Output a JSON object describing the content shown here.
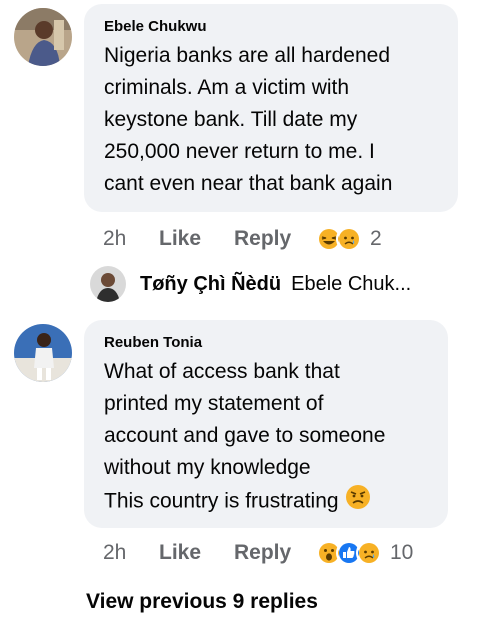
{
  "comments": [
    {
      "author": "Ebele Chukwu",
      "text": "Nigeria banks are all hardened\ncriminals. Am a victim with\nkeystone bank. Till date my\n250,000 never return to me. I\ncant even near that bank again",
      "time": "2h",
      "like_label": "Like",
      "reply_label": "Reply",
      "reaction_icons": [
        "haha-icon",
        "sad-icon"
      ],
      "reaction_count": "2"
    },
    {
      "author": "Reuben Tonia",
      "text": "What of access bank that\nprinted my statement of\naccount and gave to someone\nwithout my knowledge\nThis country is frustrating",
      "text_end_emoji": "angry-face-icon",
      "time": "2h",
      "like_label": "Like",
      "reply_label": "Reply",
      "reaction_icons": [
        "wow-icon",
        "like-icon",
        "sad-icon"
      ],
      "reaction_count": "10"
    }
  ],
  "reply_preview": {
    "name": "Tøñy Çhì Ñèdü",
    "snippet": "Ebele Chuk..."
  },
  "view_previous": "View previous 9 replies",
  "colors": {
    "bubble": "#f0f2f5",
    "secondary_text": "#65676b",
    "like_blue": "#1877f2",
    "haha_yellow": "#f7b125"
  }
}
